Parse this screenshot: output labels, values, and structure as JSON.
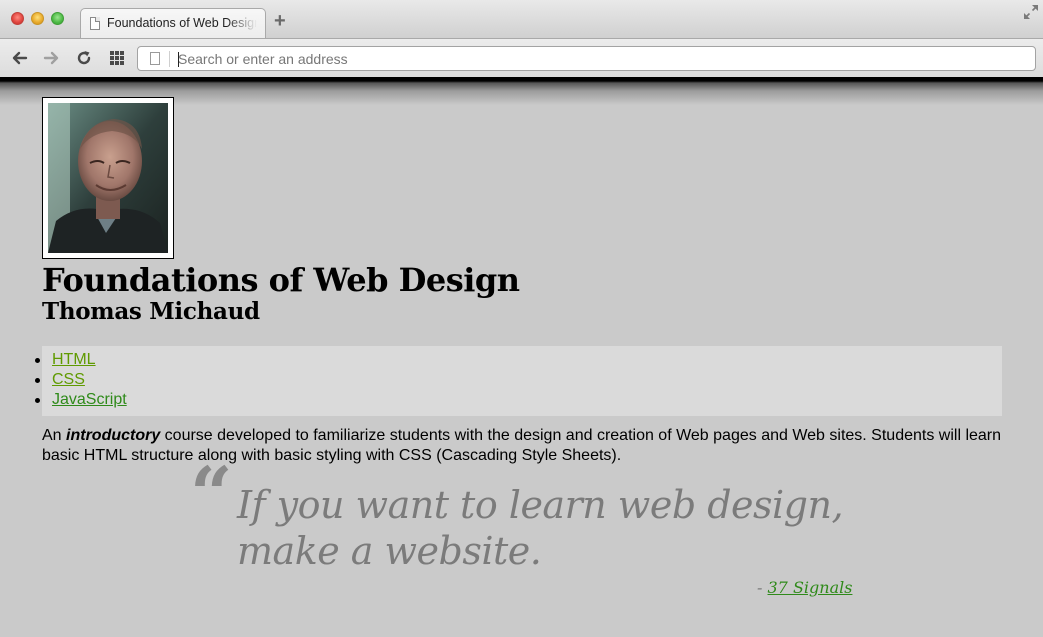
{
  "browser": {
    "tab_title": "Foundations of Web Design",
    "new_tab_label": "+",
    "address_placeholder": "Search or enter an address",
    "address_value": ""
  },
  "page": {
    "title": "Foundations of Web Design",
    "subtitle": "Thomas Michaud",
    "nav": [
      {
        "label": "HTML",
        "color": "#5f9a00"
      },
      {
        "label": "CSS",
        "color": "#5f9a00"
      },
      {
        "label": "JavaScript",
        "color": "#2f8a1a"
      }
    ],
    "intro": {
      "before": "An ",
      "emphasis": "introductory",
      "after": " course developed to familiarize students with the design and creation of Web pages and Web sites. Students will learn basic HTML structure along with basic styling with CSS (Cascading Style Sheets)."
    },
    "quote": {
      "mark": "“",
      "text": "If you want to learn web design, make a website.",
      "attribution_prefix": "- ",
      "attribution_link": "37 Signals"
    }
  },
  "colors": {
    "page_background": "#cacaca",
    "nav_background": "#dadada",
    "link_green": "#5f9a00",
    "visited_green": "#2f8a1a",
    "quote_gray": "#7b7b7b"
  }
}
